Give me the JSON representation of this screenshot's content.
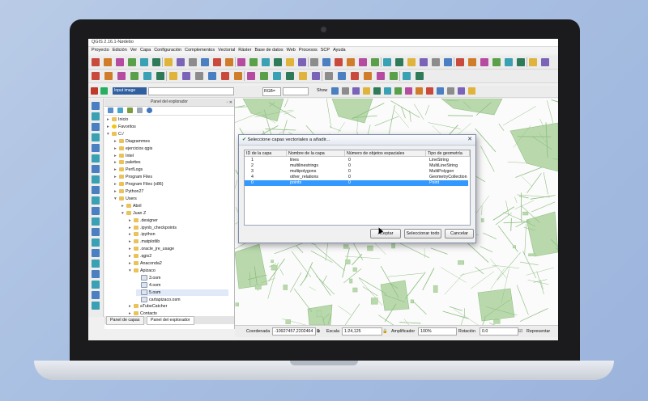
{
  "window": {
    "title": "QGIS 2.16.1-Nødebo"
  },
  "menubar": [
    "Proyecto",
    "Edición",
    "Ver",
    "Capa",
    "Configuración",
    "Complementos",
    "Vectorial",
    "Ráster",
    "Base de datos",
    "Web",
    "Procesos",
    "SCP",
    "Ayuda"
  ],
  "toolbar3": {
    "input_image": "Input image",
    "band_combo": "RGB=",
    "show_label": "Show"
  },
  "browser": {
    "title": "Panel del explorador",
    "tree": [
      {
        "label": "Inicio",
        "icon": "folder",
        "depth": 0
      },
      {
        "label": "Favoritos",
        "icon": "star",
        "depth": 0
      },
      {
        "label": "C:/",
        "icon": "folder",
        "depth": 0,
        "expanded": true
      },
      {
        "label": "Diagrammes",
        "icon": "folder",
        "depth": 1
      },
      {
        "label": "ejercicios qgis",
        "icon": "folder",
        "depth": 1
      },
      {
        "label": "Intel",
        "icon": "folder",
        "depth": 1
      },
      {
        "label": "palettes",
        "icon": "folder",
        "depth": 1
      },
      {
        "label": "PerfLogs",
        "icon": "folder",
        "depth": 1
      },
      {
        "label": "Program Files",
        "icon": "folder",
        "depth": 1
      },
      {
        "label": "Program Files (x86)",
        "icon": "folder",
        "depth": 1
      },
      {
        "label": "Python27",
        "icon": "folder",
        "depth": 1
      },
      {
        "label": "Users",
        "icon": "folder",
        "depth": 1,
        "expanded": true
      },
      {
        "label": "Abril",
        "icon": "folder",
        "depth": 2
      },
      {
        "label": "Juan Z",
        "icon": "folder",
        "depth": 2,
        "expanded": true
      },
      {
        "label": ".designer",
        "icon": "folder",
        "depth": 3
      },
      {
        "label": ".ipynb_checkpoints",
        "icon": "folder",
        "depth": 3
      },
      {
        "label": ".ipython",
        "icon": "folder",
        "depth": 3
      },
      {
        "label": ".matplotlib",
        "icon": "folder",
        "depth": 3
      },
      {
        "label": ".oracle_jre_usage",
        "icon": "folder",
        "depth": 3
      },
      {
        "label": ".qgis2",
        "icon": "folder",
        "depth": 3
      },
      {
        "label": "Anaconda2",
        "icon": "folder",
        "depth": 3
      },
      {
        "label": "Apizaco",
        "icon": "folder",
        "depth": 3,
        "expanded": true
      },
      {
        "label": "3.osm",
        "icon": "file",
        "depth": 4
      },
      {
        "label": "4.osm",
        "icon": "file",
        "depth": 4
      },
      {
        "label": "5.osm",
        "icon": "file",
        "depth": 4,
        "selected": true
      },
      {
        "label": "cartapizaco.osm",
        "icon": "file",
        "depth": 4
      },
      {
        "label": "aTubeCatcher",
        "icon": "folder",
        "depth": 3
      },
      {
        "label": "Contacts",
        "icon": "folder",
        "depth": 3
      }
    ]
  },
  "panel_tabs": [
    "Panel de capas",
    "Panel del explorador"
  ],
  "dialog": {
    "title": "Seleccione capas vectoriales a añadir...",
    "columns": [
      "ID de la capa",
      "Nombre de la capa",
      "Número de objetos espaciales",
      "Tipo de geometría"
    ],
    "rows": [
      {
        "id": "1",
        "name": "lines",
        "count": "0",
        "geom": "LineString"
      },
      {
        "id": "2",
        "name": "multilinestrings",
        "count": "0",
        "geom": "MultiLineString"
      },
      {
        "id": "3",
        "name": "multipolygons",
        "count": "0",
        "geom": "MultiPolygon"
      },
      {
        "id": "4",
        "name": "other_relations",
        "count": "0",
        "geom": "GeometryCollection"
      },
      {
        "id": "0",
        "name": "points",
        "count": "0",
        "geom": "Point",
        "selected": true
      }
    ],
    "buttons": {
      "accept": "Aceptar",
      "select_all": "Seleccionar todo",
      "cancel": "Cancelar"
    }
  },
  "statusbar": {
    "coord_label": "Coordenada",
    "coord_value": "-10927457,2202464",
    "scale_label": "Escala",
    "scale_value": "1:24,125",
    "magnifier_label": "Amplificador",
    "magnifier_value": "100%",
    "rotation_label": "Rotación",
    "rotation_value": "0.0",
    "render_label": "Representar"
  },
  "colors": {
    "map_polygon": "#b9d9ad",
    "map_line": "#8fbf82",
    "selection": "#3399ff"
  }
}
